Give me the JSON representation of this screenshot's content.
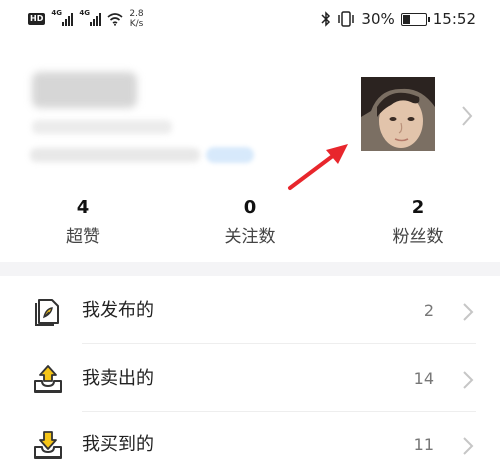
{
  "status_bar": {
    "hd_badge": "HD",
    "network_1": "4G",
    "network_2": "4G",
    "speed_value": "2.8",
    "speed_unit": "K/s",
    "battery_text": "30%",
    "time": "15:52",
    "icons": [
      "hd-icon",
      "signal-icon",
      "signal-icon",
      "wifi-icon",
      "bluetooth-icon",
      "vibrate-icon",
      "battery-icon"
    ]
  },
  "profile": {
    "avatar_icon": "avatar-photo",
    "arrow_color": "#e8262c"
  },
  "stats": [
    {
      "value": "4",
      "label": "超赞"
    },
    {
      "value": "0",
      "label": "关注数"
    },
    {
      "value": "2",
      "label": "粉丝数"
    }
  ],
  "list": [
    {
      "label": "我发布的",
      "count": "2",
      "icon": "published-doc-icon"
    },
    {
      "label": "我卖出的",
      "count": "14",
      "icon": "sold-tray-up-icon"
    },
    {
      "label": "我买到的",
      "count": "11",
      "icon": "bought-tray-down-icon"
    }
  ],
  "colors": {
    "accent_yellow": "#f5c518",
    "icon_dark": "#333333",
    "divider_band": "#f4f4f6"
  }
}
